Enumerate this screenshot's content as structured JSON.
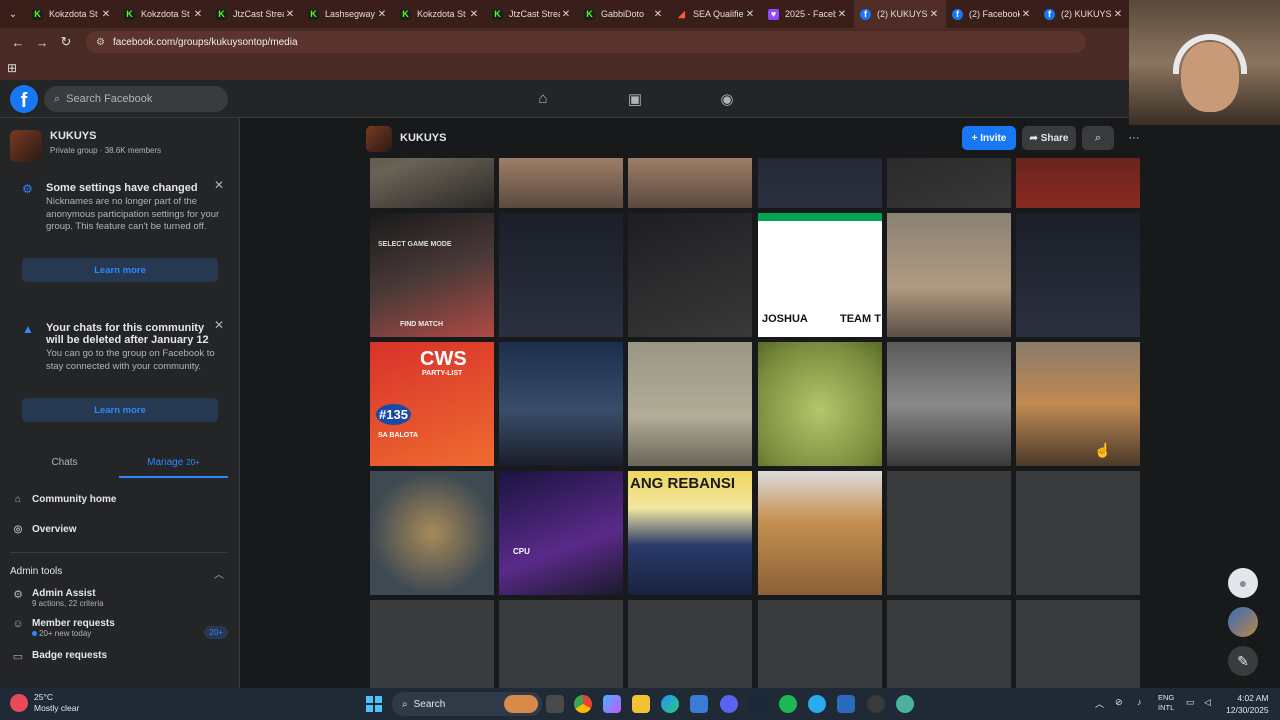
{
  "browser": {
    "tabs": [
      {
        "title": "Kokzdota St",
        "icon": "kick",
        "active": false
      },
      {
        "title": "Kokzdota St",
        "icon": "kick",
        "active": false
      },
      {
        "title": "JtzCast Strea",
        "icon": "kick",
        "active": false
      },
      {
        "title": "Lashsegway",
        "icon": "kick",
        "active": false
      },
      {
        "title": "Kokzdota St",
        "icon": "kick",
        "active": false
      },
      {
        "title": "JtzCast Strea",
        "icon": "kick",
        "active": false
      },
      {
        "title": "GabbiDoto",
        "icon": "kick",
        "active": false
      },
      {
        "title": "SEA Qualifie",
        "icon": "sea",
        "active": false
      },
      {
        "title": "2025 - Faceb",
        "icon": "twitch",
        "active": false
      },
      {
        "title": "(2) KUKUYS",
        "icon": "facebook",
        "active": true
      },
      {
        "title": "(2) Facebook",
        "icon": "facebook",
        "active": false
      },
      {
        "title": "(2) KUKUYS",
        "icon": "facebook",
        "active": false
      }
    ],
    "url": "facebook.com/groups/kukuysontop/media"
  },
  "fb": {
    "search_placeholder": "Search Facebook"
  },
  "group": {
    "name": "KUKUYS",
    "meta": "Private group · 38.6K members"
  },
  "notices": [
    {
      "title": "Some settings have changed",
      "body": "Nicknames are no longer part of the anonymous participation settings for your group. This feature can't be turned off.",
      "button": "Learn more",
      "icon": "settings-icon"
    },
    {
      "title": "Your chats for this community will be deleted after January 12",
      "body": "You can go to the group on Facebook to stay connected with your community.",
      "button": "Learn more",
      "icon": "warning-icon"
    }
  ],
  "side_tabs": {
    "chats": "Chats",
    "manage": "Manage",
    "manage_count": "20+"
  },
  "side_links": {
    "community_home": "Community home",
    "overview": "Overview"
  },
  "admin_tools": {
    "header": "Admin tools",
    "admin_assist": {
      "title": "Admin Assist",
      "sub": "9 actions, 22 criteria"
    },
    "member_requests": {
      "title": "Member requests",
      "sub": "20+ new today",
      "badge": "20+"
    },
    "badge_requests": {
      "title": "Badge requests"
    }
  },
  "main": {
    "group_name": "KUKUYS",
    "invite": "Invite",
    "share": "Share"
  },
  "media_texts": {
    "joshua": "JOSHUA",
    "team": "TEAM T",
    "cws": "CWS",
    "party_list": "PARTY-LIST",
    "num": "#135",
    "balota": "SA BALOTA",
    "rebansi": "ANG REBANSI",
    "cpu": "CPU",
    "select_game_mode": "SELECT GAME MODE",
    "find_match": "FIND MATCH"
  },
  "taskbar": {
    "temp": "25°C",
    "weather": "Mostly clear",
    "search": "Search",
    "lang1": "ENG",
    "lang2": "INTL",
    "time": "4:02 AM",
    "date": "12/30/2025"
  }
}
